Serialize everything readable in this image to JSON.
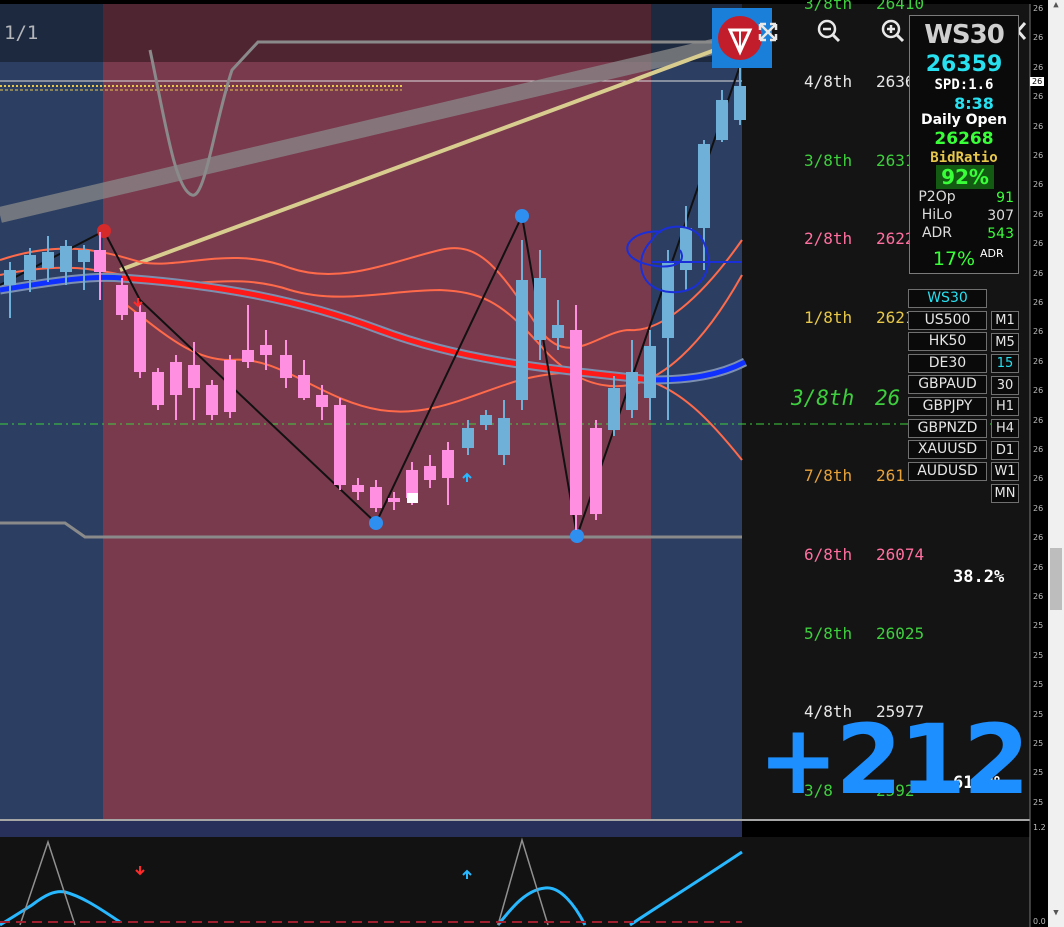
{
  "toolbar": {
    "page_indicator": "1/1",
    "zoom_out_icon": "zoom-out-icon",
    "zoom_in_icon": "zoom-in-icon",
    "expand_icon": "expand-arrows-icon",
    "close_icon": "close-icon",
    "logo_icon": "tradingview-logo-icon"
  },
  "murrey_levels": [
    {
      "label": "3/8th",
      "value": "26410",
      "color": "#3ecf3e"
    },
    {
      "label": "4/8th",
      "value": "2636",
      "color": "#e6e6e6"
    },
    {
      "label": "3/8th",
      "value": "2631",
      "color": "#3ecf3e"
    },
    {
      "label": "2/8th",
      "value": "2622",
      "color": "#ff6fa0"
    },
    {
      "label": "1/8th",
      "value": "2621",
      "color": "#e7c84a"
    },
    {
      "label": "3/8th",
      "value": "26",
      "color": "#3ecf3e"
    },
    {
      "label": "7/8th",
      "value": "261",
      "color": "#e7a23a"
    },
    {
      "label": "6/8th",
      "value": "26074",
      "color": "#ff6fa0"
    },
    {
      "label": "5/8th",
      "value": "26025",
      "color": "#3ecf3e"
    },
    {
      "label": "4/8th",
      "value": "25977",
      "color": "#e6e6e6"
    },
    {
      "label": "3/8",
      "value": "2592",
      "color": "#3ecf3e"
    }
  ],
  "fib": {
    "upper": "38.2%",
    "lower": "61.8%"
  },
  "big_change": "+212",
  "info_panel": {
    "symbol": "WS30",
    "price": "26359",
    "spread": "SPD:1.6",
    "time": "8:38",
    "daily_open_label": "Daily Open",
    "daily_open": "26268",
    "bid_ratio_label": "BidRatio",
    "bid_ratio": "92%",
    "p2op_label": "P2Op",
    "p2op": "91",
    "hilo_label": "HiLo",
    "hilo": "307",
    "adr_label": "ADR",
    "adr": "543",
    "adr_pct": "17%",
    "adr_suffix": "ADR"
  },
  "symbols": [
    "WS30",
    "US500",
    "HK50",
    "DE30",
    "GBPAUD",
    "GBPJPY",
    "GBPNZD",
    "XAUUSD",
    "AUDUSD"
  ],
  "active_symbol": "WS30",
  "timeframes": [
    "M1",
    "M5",
    "15",
    "30",
    "H1",
    "H4",
    "D1",
    "W1",
    "MN"
  ],
  "active_timeframe": "15",
  "price_axis": [
    "26",
    "26",
    "26",
    "26",
    "26",
    "26",
    "26",
    "26",
    "26",
    "26",
    "26",
    "26",
    "26",
    "26",
    "26",
    "26",
    "26",
    "26",
    "26",
    "26",
    "26",
    "25",
    "25",
    "25",
    "25",
    "25",
    "25",
    "25"
  ],
  "price_axis_marker": "26",
  "indicator_axis": {
    "top": "1.2",
    "bottom": "0.0"
  },
  "colors": {
    "bull": "#6fb0d8",
    "bear": "#ff8fe0",
    "ma_bear": "#ff1a1a",
    "ma_bull": "#1030ff",
    "envelope": "#ff6a4a",
    "session_red": "#7a3a4e",
    "session_blue": "#2c3f62"
  }
}
